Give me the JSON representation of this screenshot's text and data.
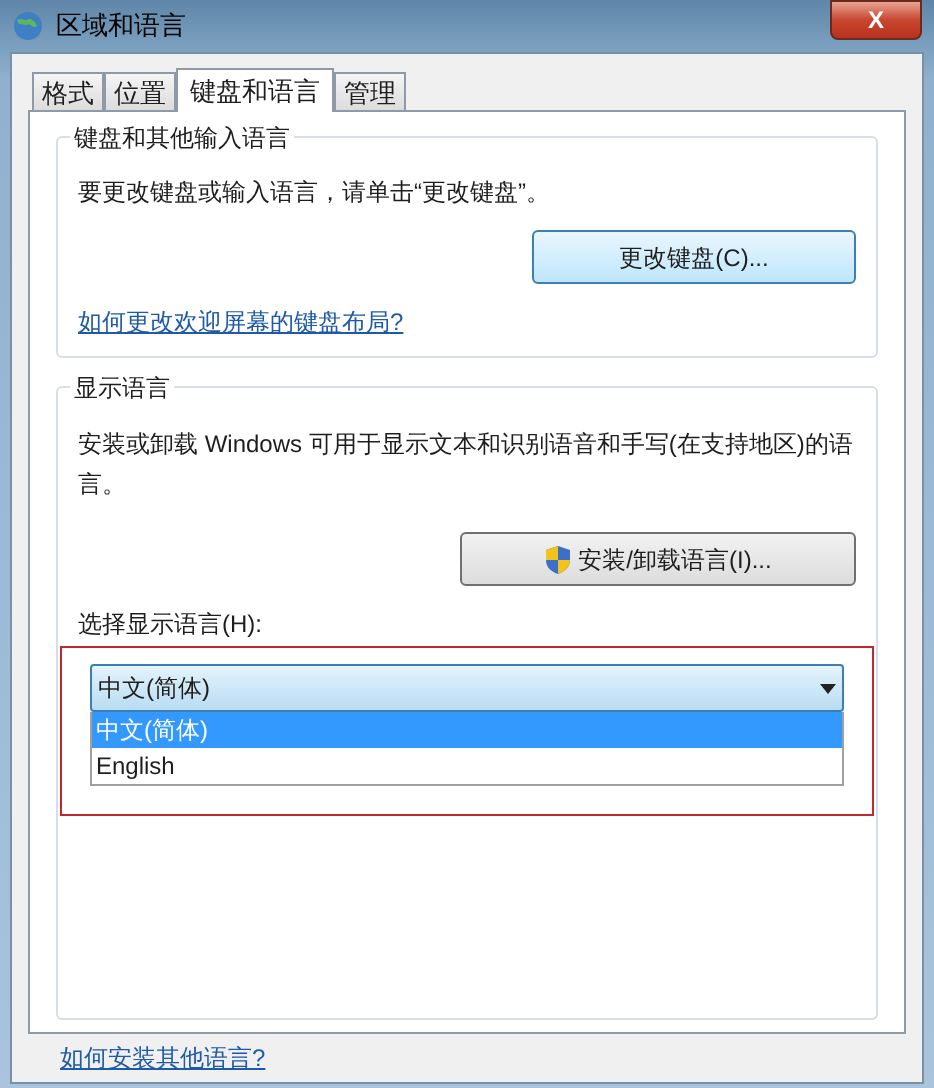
{
  "window": {
    "title": "区域和语言",
    "close": "X"
  },
  "tabs": [
    {
      "label": "格式",
      "selected": false
    },
    {
      "label": "位置",
      "selected": false
    },
    {
      "label": "键盘和语言",
      "selected": true
    },
    {
      "label": "管理",
      "selected": false
    }
  ],
  "keyboard_group": {
    "title": "键盘和其他输入语言",
    "description": "要更改键盘或输入语言，请单击“更改键盘”。",
    "button": "更改键盘(C)...",
    "link": "如何更改欢迎屏幕的键盘布局?"
  },
  "display_group": {
    "title": "显示语言",
    "description": "安装或卸载 Windows 可用于显示文本和识别语音和手写(在支持地区)的语言。",
    "button": "安装/卸载语言(I)...",
    "select_label": "选择显示语言(H):",
    "dropdown": {
      "value": "中文(简体)",
      "expanded": true,
      "options": [
        {
          "label": "中文(简体)",
          "selected": true
        },
        {
          "label": "English",
          "selected": false
        }
      ]
    }
  },
  "footer_link": "如何安装其他语言?"
}
